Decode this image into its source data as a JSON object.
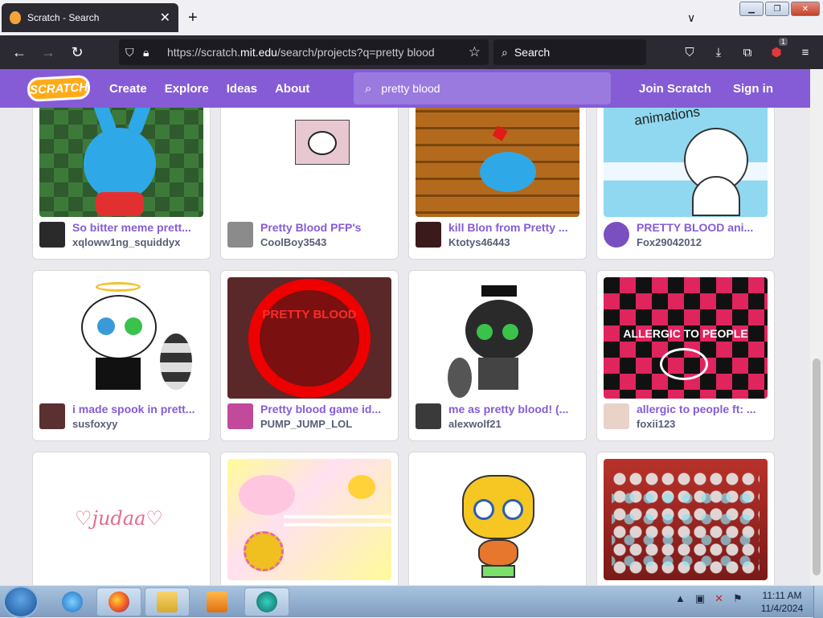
{
  "browser": {
    "tab_title": "Scratch - Search",
    "new_tab": "+",
    "tab_list": "∨",
    "url_prefix": "https://scratch.",
    "url_domain": "mit.edu",
    "url_path": "/search/projects?q=pretty blood",
    "search_placeholder": "Search",
    "extension_badge": "1"
  },
  "header": {
    "logo": "SCRATCH",
    "nav": [
      "Create",
      "Explore",
      "Ideas",
      "About"
    ],
    "search_value": "pretty blood",
    "join": "Join Scratch",
    "signin": "Sign in"
  },
  "projects": [
    {
      "title": "So bitter meme prett...",
      "author": "xqloww1ng_squiddyx",
      "thumb_color": "#3c6b3a",
      "avatar_color": "#2a2a2a"
    },
    {
      "title": "Pretty Blood PFP's",
      "author": "CoolBoy3543",
      "thumb_color": "#ffffff",
      "avatar_color": "#8b8b8b"
    },
    {
      "title": "kill Blon from Pretty ...",
      "author": "Ktotys46443",
      "thumb_color": "#b36a1c",
      "avatar_color": "#3a1a1a"
    },
    {
      "title": "PRETTY BLOOD ani...",
      "author": "Fox29042012",
      "thumb_color": "#8fd8f0",
      "avatar_color": "#7a4fc0"
    },
    {
      "title": "i made spook in prett...",
      "author": "susfoxyy",
      "thumb_color": "#ffffff",
      "avatar_color": "#5a3030"
    },
    {
      "title": "Pretty blood game id...",
      "author": "PUMP_JUMP_LOL",
      "thumb_color": "#5a2828",
      "avatar_color": "#c24a9a"
    },
    {
      "title": "me as pretty blood! (...",
      "author": "alexwolf21",
      "thumb_color": "#ffffff",
      "avatar_color": "#3a3a3a"
    },
    {
      "title": "allergic to people ft: ...",
      "author": "foxii123",
      "thumb_color": "#e0245e",
      "avatar_color": "#e9d3c8"
    },
    {
      "title": "",
      "author": "",
      "thumb_color": "#ffffff",
      "avatar_color": "#ffffff"
    },
    {
      "title": "",
      "author": "",
      "thumb_color": "#fffb9a",
      "avatar_color": "#ffffff"
    },
    {
      "title": "",
      "author": "",
      "thumb_color": "#ffffff",
      "avatar_color": "#ffffff"
    },
    {
      "title": "",
      "author": "",
      "thumb_color": "#b8322a",
      "avatar_color": "#ffffff"
    }
  ],
  "thumb_text": {
    "p5": "PRETTY BLOOD",
    "p8": "ALLERGIC TO PEOPLE",
    "p9": "judaa",
    "p4": "animations"
  },
  "taskbar": {
    "time": "11:11 AM",
    "date": "11/4/2024"
  }
}
